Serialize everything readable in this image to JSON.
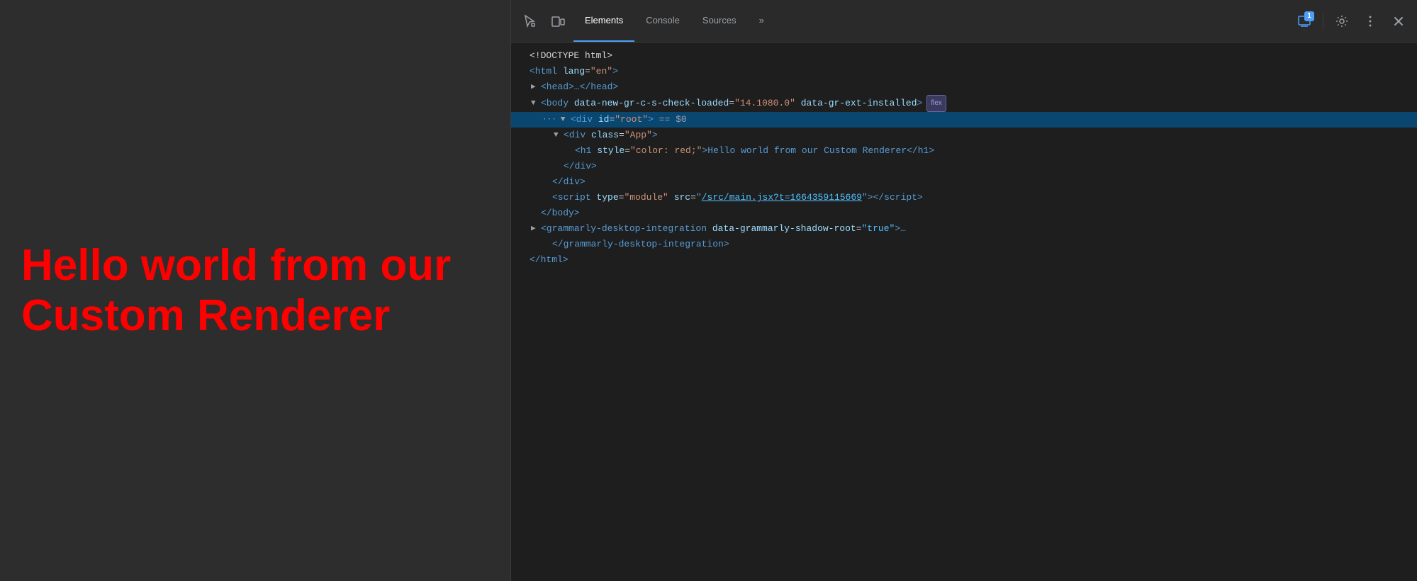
{
  "browser": {
    "heading": "Hello world from our Custom Renderer"
  },
  "devtools": {
    "toolbar": {
      "inspect_label": "Inspect element",
      "device_label": "Toggle device toolbar",
      "tabs": [
        {
          "id": "elements",
          "label": "Elements",
          "active": true
        },
        {
          "id": "console",
          "label": "Console",
          "active": false
        },
        {
          "id": "sources",
          "label": "Sources",
          "active": false
        },
        {
          "id": "more",
          "label": "»",
          "active": false
        }
      ],
      "notification_count": "1",
      "settings_label": "Settings",
      "more_label": "More options",
      "close_label": "Close DevTools"
    },
    "dom": {
      "lines": [
        {
          "id": "doctype",
          "indent": 0,
          "content": "<!DOCTYPE html>",
          "type": "doctype"
        },
        {
          "id": "html-open",
          "indent": 0,
          "content": "<html lang=\"en\">",
          "type": "tag"
        },
        {
          "id": "head",
          "indent": 1,
          "content": "▶ <head>…</head>",
          "type": "collapsed"
        },
        {
          "id": "body-open",
          "indent": 1,
          "content": "▼ <body data-new-gr-c-s-check-loaded=\"14.1080.0\" data-gr-ext-installed>",
          "type": "expanded",
          "badge": "flex"
        },
        {
          "id": "div-root",
          "indent": 2,
          "content": "▼ <div id=\"root\"> == $0",
          "type": "selected"
        },
        {
          "id": "div-app",
          "indent": 3,
          "content": "▼ <div class=\"App\">",
          "type": "expanded"
        },
        {
          "id": "h1",
          "indent": 4,
          "content": "<h1 style=\"color: red;\">Hello world from our Custom Renderer</h1>",
          "type": "tag"
        },
        {
          "id": "div-app-close",
          "indent": 3,
          "content": "</div>",
          "type": "tag"
        },
        {
          "id": "div-root-close",
          "indent": 2,
          "content": "</div>",
          "type": "tag"
        },
        {
          "id": "script",
          "indent": 2,
          "content": "<script type=\"module\" src=\"/src/main.jsx?t=1664359115669\"></script>",
          "type": "tag",
          "has_link": true
        },
        {
          "id": "body-close",
          "indent": 1,
          "content": "</body>",
          "type": "tag"
        },
        {
          "id": "grammarly-open",
          "indent": 1,
          "content": "▶ <grammarly-desktop-integration data-grammarly-shadow-root=\"true\">…",
          "type": "collapsed"
        },
        {
          "id": "grammarly-close",
          "indent": 2,
          "content": "</grammarly-desktop-integration>",
          "type": "tag"
        },
        {
          "id": "html-close",
          "indent": 0,
          "content": "</html>",
          "type": "tag"
        }
      ]
    }
  }
}
